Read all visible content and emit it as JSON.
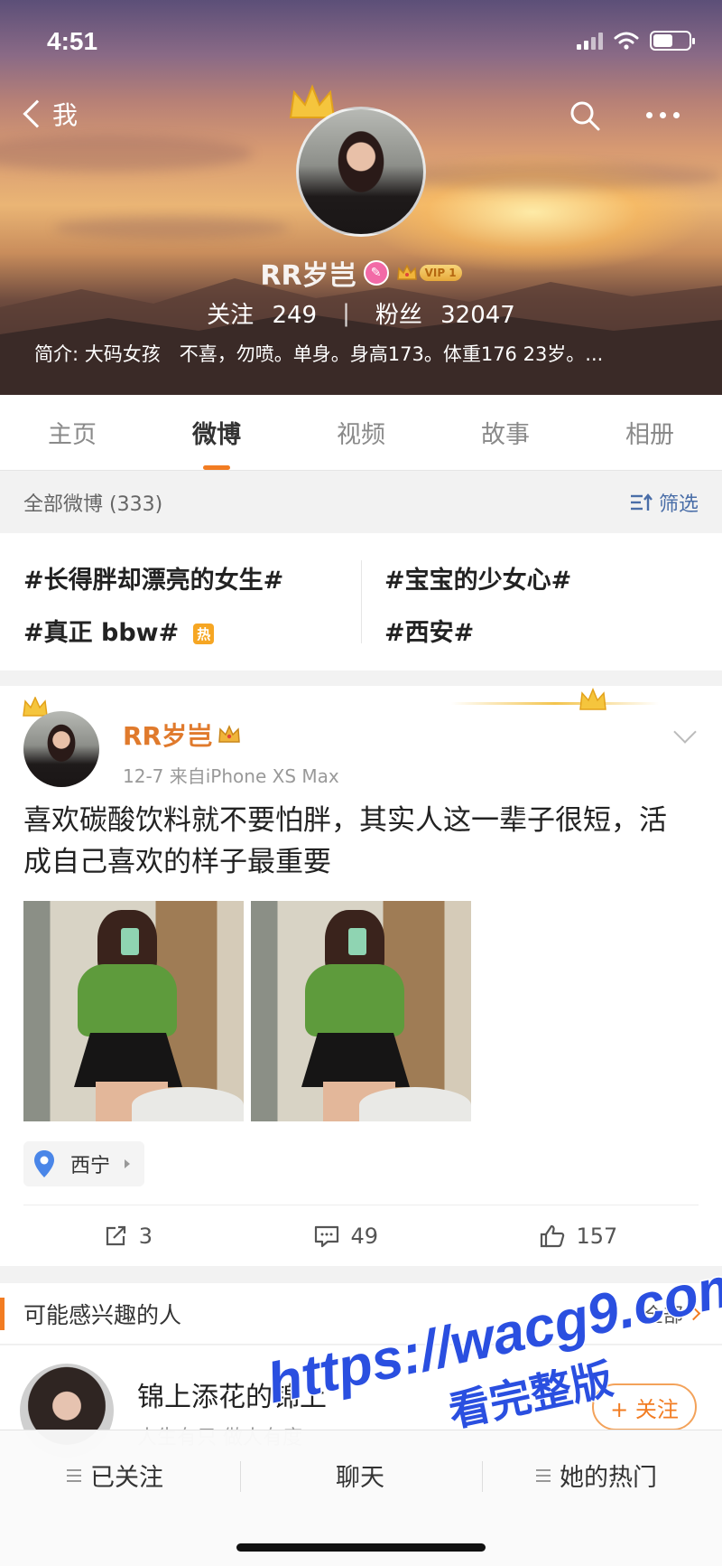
{
  "status_bar": {
    "time": "4:51"
  },
  "nav": {
    "back_label": "我"
  },
  "profile": {
    "name": "RR岁岂",
    "vip_label": "VIP 1",
    "following_label": "关注",
    "following_count": "249",
    "followers_label": "粉丝",
    "followers_count": "32047",
    "bio": "简介: 大码女孩　不喜，勿喷。单身。身高173。体重176  23岁。..."
  },
  "tabs": [
    {
      "label": "主页",
      "active": false
    },
    {
      "label": "微博",
      "active": true
    },
    {
      "label": "视频",
      "active": false
    },
    {
      "label": "故事",
      "active": false
    },
    {
      "label": "相册",
      "active": false
    }
  ],
  "filter": {
    "count_label": "全部微博 (333)",
    "button_label": "筛选"
  },
  "topics": {
    "items": [
      "#长得胖却漂亮的女生#",
      "#宝宝的少女心#",
      "#真正 bbw#",
      "#西安#"
    ],
    "hot_tag": "热"
  },
  "post": {
    "author": "RR岁岂",
    "meta": "12-7  来自iPhone XS Max",
    "text": "喜欢碳酸饮料就不要怕胖，其实人这一辈子很短，活成自己喜欢的样子最重要",
    "location": "西宁",
    "reposts": "3",
    "comments": "49",
    "likes": "157"
  },
  "recommend": {
    "title": "可能感兴趣的人",
    "all_label": "全部",
    "user_name": "锦上添花的锦上",
    "user_sub": "人生有只 做人有度",
    "follow_label": "+ 关注"
  },
  "bottom_bar": {
    "following_label": "已关注",
    "chat_label": "聊天",
    "hot_label": "她的热门"
  },
  "watermark": {
    "url": "https://wacg9.com",
    "sub": "看完整版"
  },
  "colors": {
    "accent": "#f27c22",
    "link": "#4a6ea8",
    "watermark": "#2a4fe0"
  }
}
